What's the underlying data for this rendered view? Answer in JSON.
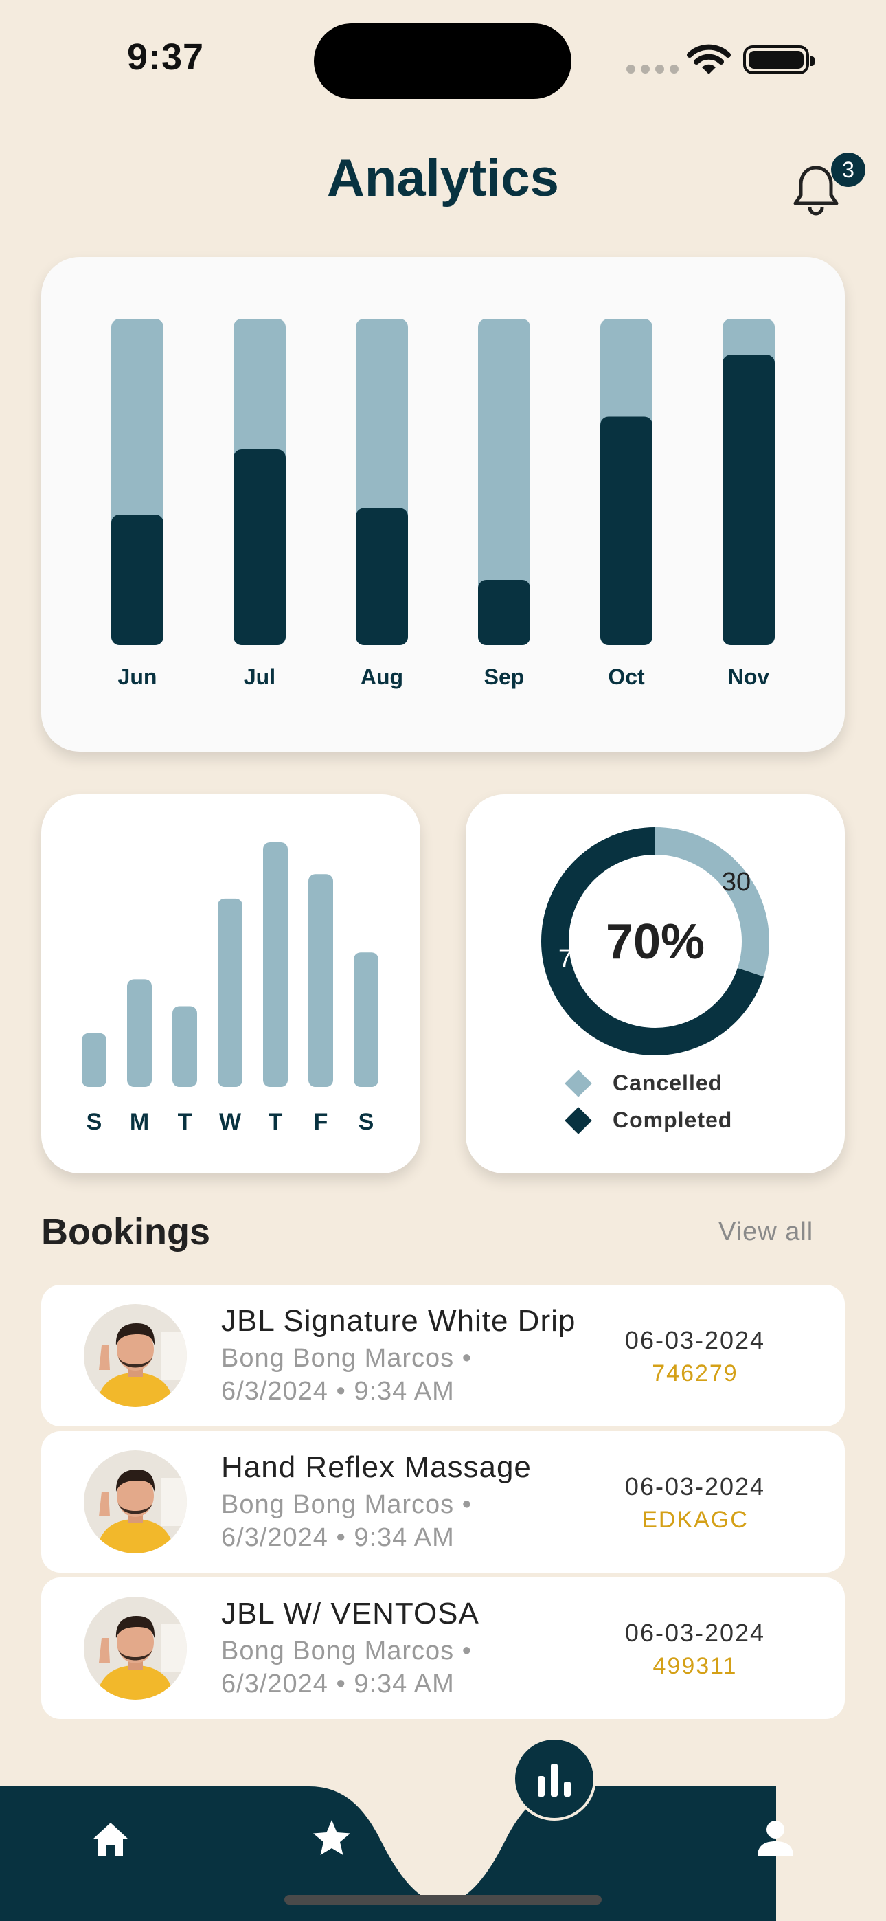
{
  "status_bar": {
    "time": "9:37"
  },
  "header": {
    "title": "Analytics",
    "notification_count": "3"
  },
  "colors": {
    "primary": "#083240",
    "light": "#96b8c4",
    "accent": "#d4a017",
    "background": "#f4ebde"
  },
  "chart_data": [
    {
      "type": "bar",
      "stacked": true,
      "categories": [
        "Jun",
        "Jul",
        "Aug",
        "Sep",
        "Oct",
        "Nov"
      ],
      "series": [
        {
          "values": [
            40,
            60,
            42,
            20,
            70,
            89
          ]
        },
        {
          "values": [
            60,
            40,
            58,
            80,
            30,
            11
          ]
        }
      ],
      "ylim": [
        0,
        100
      ]
    },
    {
      "type": "bar",
      "categories": [
        "S",
        "M",
        "T",
        "W",
        "T",
        "F",
        "S"
      ],
      "values": [
        22,
        44,
        33,
        77,
        100,
        87,
        55
      ],
      "ylim": [
        0,
        100
      ]
    },
    {
      "type": "pie",
      "donut": true,
      "center_label": "70%",
      "labels": [
        "Cancelled",
        "Completed"
      ],
      "values": [
        30,
        70
      ]
    }
  ],
  "bookings": {
    "title": "Bookings",
    "view_all": "View all",
    "items": [
      {
        "service": "JBL Signature White Drip",
        "customer": "Bong Bong Marcos •",
        "datetime": "6/3/2024 • 9:34 AM",
        "date": "06-03-2024",
        "code": "746279"
      },
      {
        "service": "Hand Reflex Massage",
        "customer": "Bong Bong Marcos •",
        "datetime": "6/3/2024 • 9:34 AM",
        "date": "06-03-2024",
        "code": "EDKAGC"
      },
      {
        "service": "JBL W/ VENTOSA",
        "customer": "Bong Bong Marcos •",
        "datetime": "6/3/2024 • 9:34 AM",
        "date": "06-03-2024",
        "code": "499311"
      }
    ]
  },
  "tabbar": {
    "icons": [
      "home-icon",
      "star-icon",
      "bar-chart-icon",
      "person-icon"
    ],
    "active": "bar-chart-icon"
  }
}
